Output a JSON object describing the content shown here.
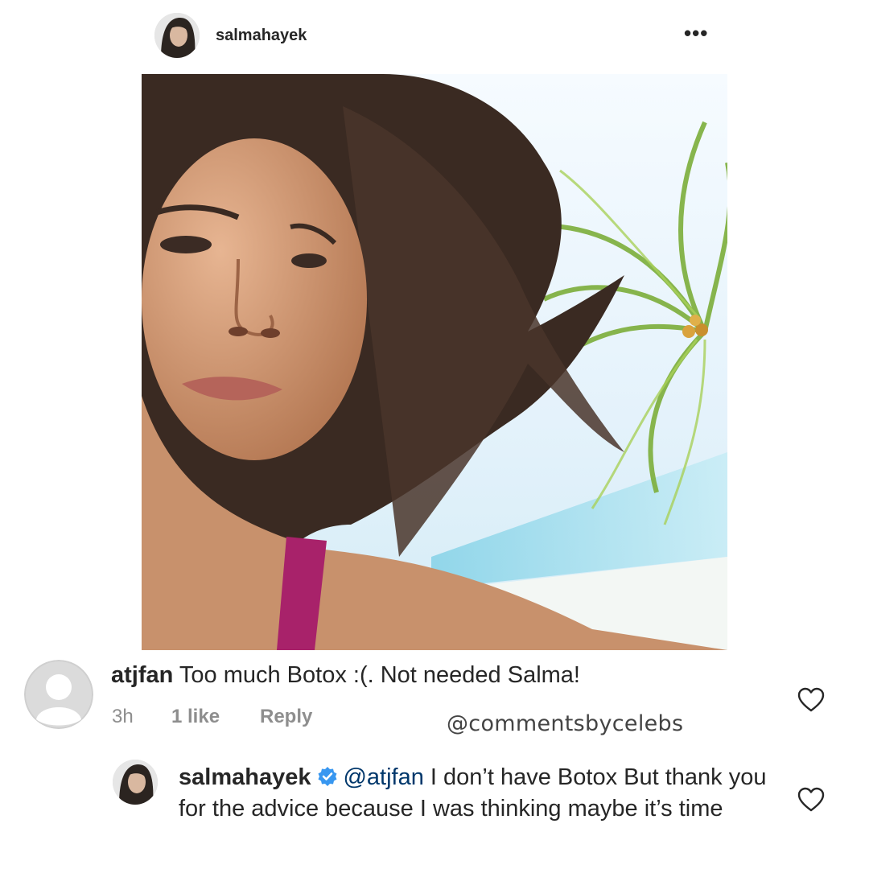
{
  "post": {
    "username": "salmahayek",
    "more_label": "•••"
  },
  "comment": {
    "username": "atjfan",
    "text": "Too much Botox :(. Not needed Salma!",
    "time": "3h",
    "likes": "1 like",
    "reply_label": "Reply",
    "heart_icon": "heart-outline-icon"
  },
  "watermark": "@commentsbycelebs",
  "reply": {
    "username": "salmahayek",
    "verified_icon": "verified-badge-icon",
    "mention": "@atjfan",
    "text": " I don’t have Botox  But thank you for the advice because I was thinking maybe it’s time",
    "heart_icon": "heart-outline-icon"
  },
  "colors": {
    "text": "#262626",
    "secondary": "#8e8e8e",
    "mention": "#00376b",
    "verified": "#3897f0"
  }
}
